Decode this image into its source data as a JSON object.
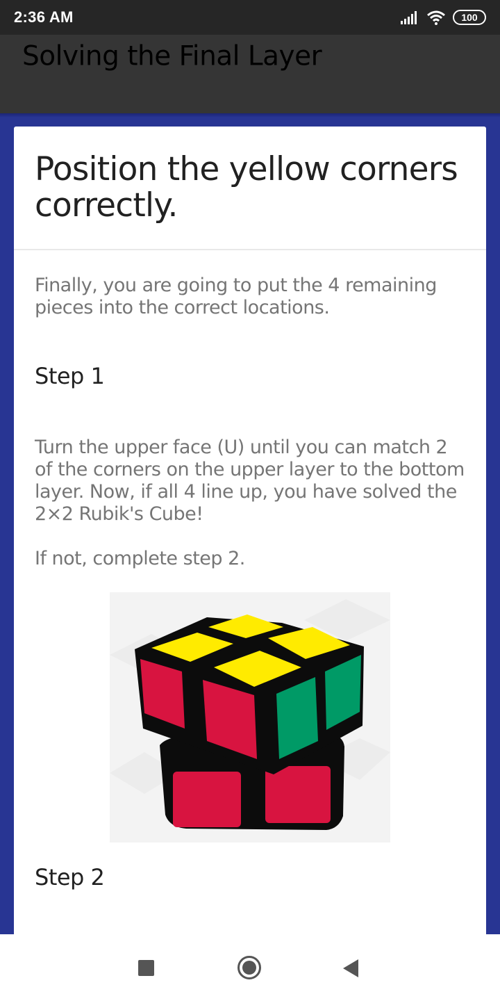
{
  "status_bar": {
    "time": "2:36 AM",
    "battery": "100",
    "icons": [
      "signal-icon",
      "wifi-icon",
      "battery-icon"
    ]
  },
  "app_bar": {
    "title": "Solving the Final Layer"
  },
  "card": {
    "heading": "Position the yellow corners correctly.",
    "intro": "Finally, you are going to put the 4 remaining pieces into the correct locations.",
    "step1": {
      "title": "Step 1",
      "body": "Turn the upper face (U) until you can match 2 of the corners on the upper layer to the bottom layer. Now, if all 4 line up, you have solved the 2×2 Rubik's Cube!",
      "followup": "If not, complete step 2."
    },
    "step2": {
      "title": "Step 2"
    }
  },
  "colors": {
    "background": "#283593",
    "app_bar": "#353535",
    "status_bar": "#262626",
    "cube_yellow": "#FFEB00",
    "cube_red": "#D81440",
    "cube_green": "#009A66"
  },
  "nav_bar": {
    "icons": [
      "recent-apps-icon",
      "home-icon",
      "back-icon"
    ]
  }
}
